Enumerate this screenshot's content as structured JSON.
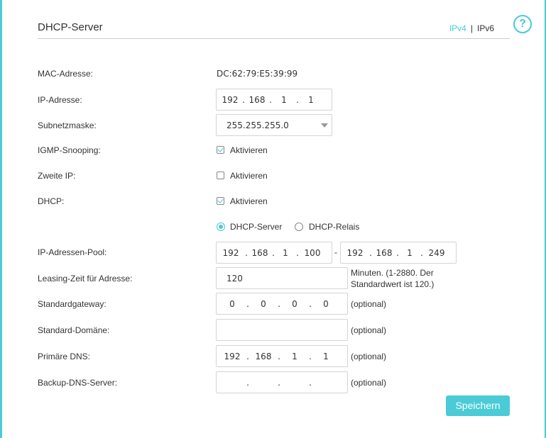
{
  "header": {
    "title": "DHCP-Server",
    "ipv4": "IPv4",
    "sep": "|",
    "ipv6": "IPv6",
    "help": "?"
  },
  "labels": {
    "mac": "MAC-Adresse:",
    "ip": "IP-Adresse:",
    "subnet": "Subnetzmaske:",
    "igmp": "IGMP-Snooping:",
    "second_ip": "Zweite IP:",
    "dhcp": "DHCP:",
    "pool": "IP-Adressen-Pool:",
    "lease": "Leasing-Zeit für Adresse:",
    "gateway": "Standardgateway:",
    "domain": "Standard-Domäne:",
    "dns1": "Primäre DNS:",
    "dns2": "Backup-DNS-Server:"
  },
  "values": {
    "mac": "DC:62:79:E5:39:99",
    "ip": [
      "192",
      "168",
      "1",
      "1"
    ],
    "subnet": "255.255.255.0",
    "igmp_label": "Aktivieren",
    "second_ip_label": "Aktivieren",
    "dhcp_label": "Aktivieren",
    "mode_server": "DHCP-Server",
    "mode_relay": "DHCP-Relais",
    "pool_start": [
      "192",
      "168",
      "1",
      "100"
    ],
    "pool_dash": "-",
    "pool_end": [
      "192",
      "168",
      "1",
      "249"
    ],
    "lease": "120",
    "lease_hint_1": "Minuten. (1-2880. Der",
    "lease_hint_2": "Standardwert ist 120.)",
    "gateway": [
      "0",
      "0",
      "0",
      "0"
    ],
    "domain": "",
    "dns1": [
      "192",
      "168",
      "1",
      "1"
    ],
    "dns2": [
      "",
      "",
      "",
      ""
    ],
    "optional": "(optional)"
  },
  "state": {
    "igmp_enabled": true,
    "second_ip_enabled": false,
    "dhcp_enabled": true,
    "mode": "DHCP-Server"
  },
  "button": {
    "save": "Speichern"
  },
  "colors": {
    "accent": "#4acbd6"
  }
}
